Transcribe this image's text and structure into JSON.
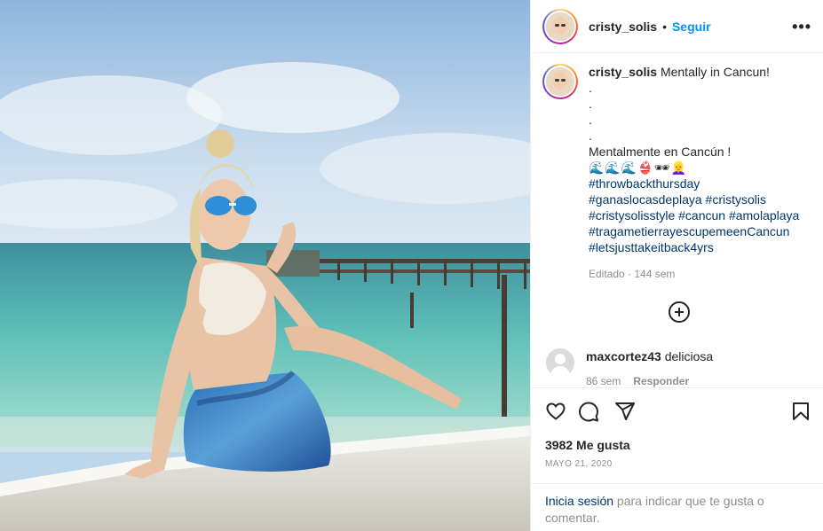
{
  "post": {
    "photo_alt": "cristy_solis post photo",
    "username": "cristy_solis",
    "separator": "•",
    "follow_label": "Seguir",
    "more_label": "•••"
  },
  "caption": {
    "username": "cristy_solis",
    "line1": " Mentally in Cancun!",
    "dots": [
      ".",
      ".",
      ".",
      "."
    ],
    "spanish": "Mentalmente en Cancún !",
    "emojis": "🌊🌊🌊👙🕶👱‍♀️",
    "hashtags": [
      "#throwbackthursday",
      "#ganaslocasdeplaya #cristysolis",
      "#cristysolisstyle #cancun #amolaplaya",
      "#tragametierrayescupemeenCancun",
      "#letsjusttakeitback4yrs"
    ],
    "meta": "Editado · 144 sem"
  },
  "comment": {
    "username": "maxcortez43",
    "text": " deliciosa",
    "time": "86 sem",
    "reply_label": "Responder"
  },
  "stats": {
    "likes": "3982 Me gusta",
    "date": "MAYO 21, 2020"
  },
  "login": {
    "link": "Inicia sesión",
    "rest": " para indicar que te gusta o comentar."
  },
  "icons": [
    "heart-icon",
    "comment-icon",
    "share-icon",
    "save-icon",
    "add-comment-icon",
    "more-options-icon"
  ],
  "colors": {
    "accent": "#0095f6",
    "text": "#262626",
    "muted": "#8e8e8e",
    "hashtag": "#00376b",
    "border": "#efefef"
  }
}
